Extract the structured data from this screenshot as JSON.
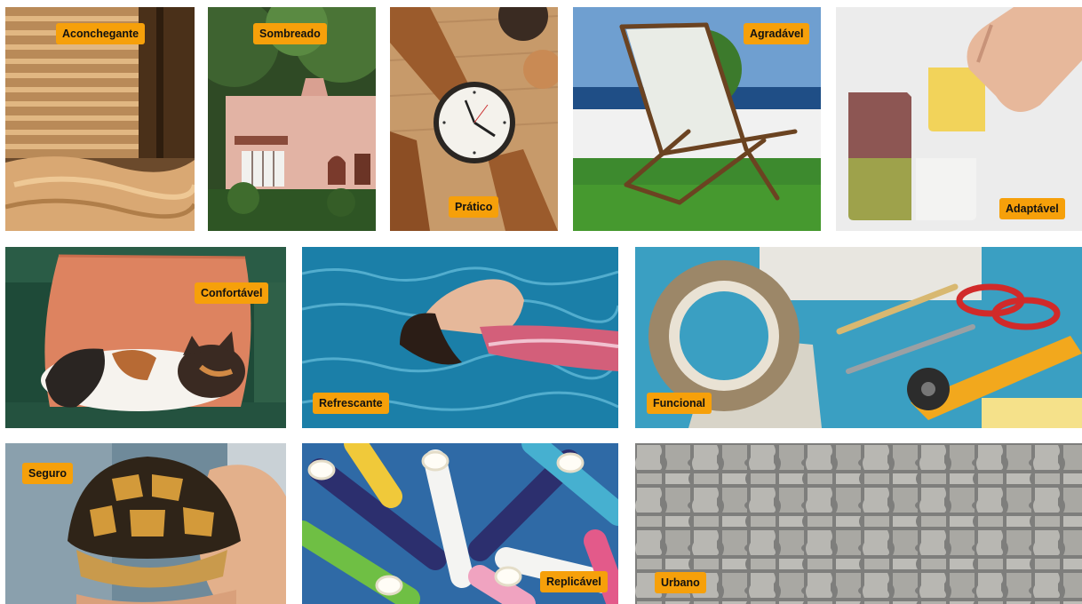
{
  "gallery": {
    "tiles": [
      {
        "label": "Aconchegante",
        "scene": "sunlit bed with window blinds"
      },
      {
        "label": "Sombreado",
        "scene": "pink house among trees"
      },
      {
        "label": "Prático",
        "scene": "wristwatch with leather strap"
      },
      {
        "label": "Agradável",
        "scene": "wooden deck chair on lawn by the sea"
      },
      {
        "label": "Adaptável",
        "scene": "hand arranging colored tiles"
      },
      {
        "label": "Confortável",
        "scene": "calico cat sleeping on cushion"
      },
      {
        "label": "Refrescante",
        "scene": "woman floating in pool"
      },
      {
        "label": "Funcional",
        "scene": "tape, scissors and cutter on mat"
      },
      {
        "label": "Seguro",
        "scene": "tortoise held in hand"
      },
      {
        "label": "Replicável",
        "scene": "striped paper straws"
      },
      {
        "label": "Urbano",
        "scene": "interlocking paving stones"
      }
    ]
  },
  "colors": {
    "label_bg": "#f6a00a",
    "label_text": "#111111",
    "page_bg": "#ffffff"
  }
}
